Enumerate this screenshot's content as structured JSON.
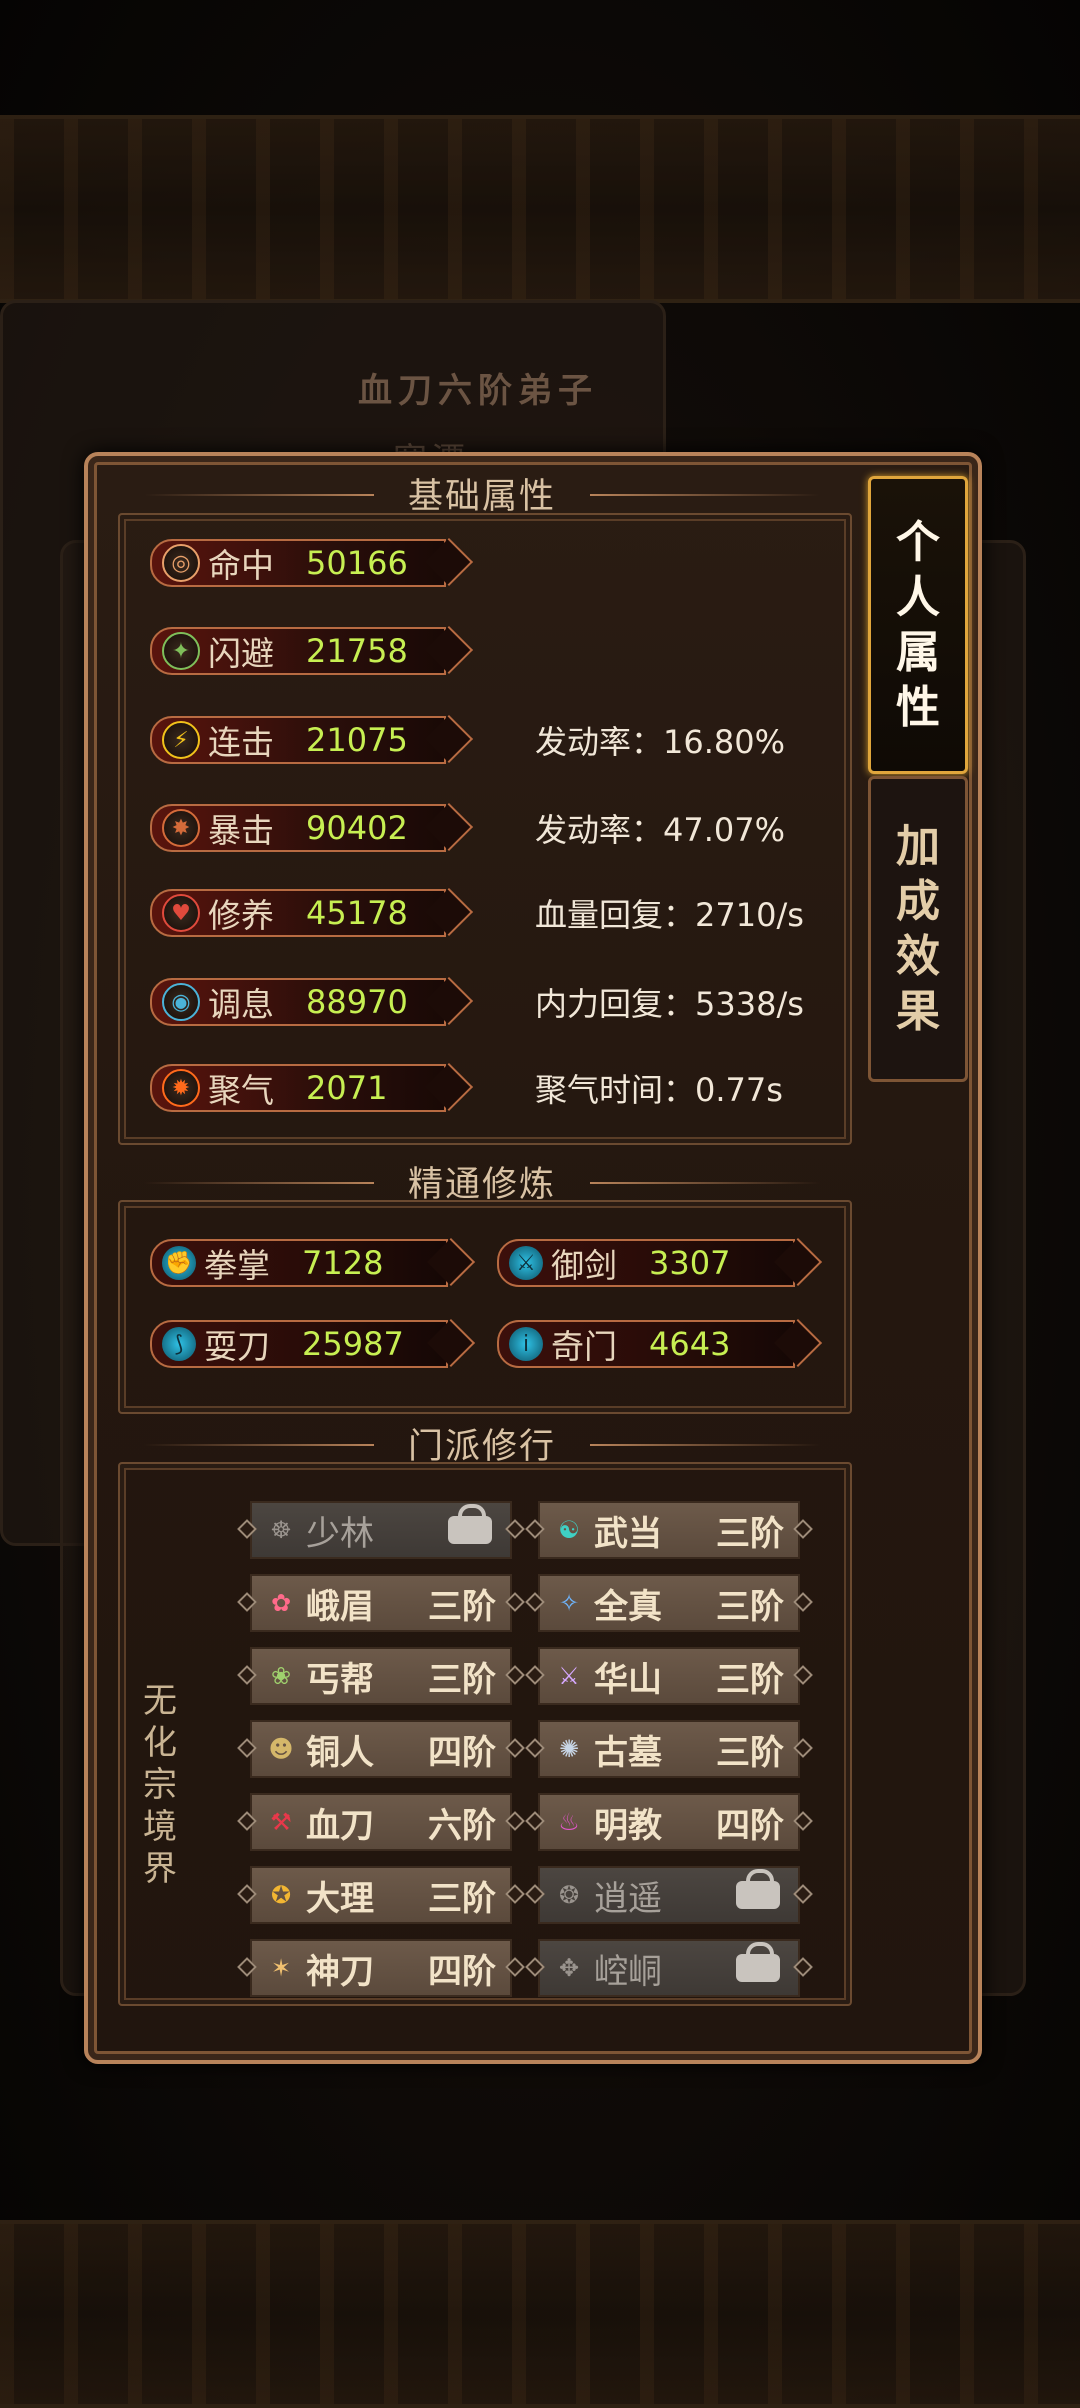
{
  "background": {
    "title_text": "血刀六阶弟子",
    "sub_text": "寒潭"
  },
  "sections": {
    "basic": "基础属性",
    "mastery": "精通修炼",
    "sect": "门派修行"
  },
  "basic_stats": [
    {
      "name": "命中",
      "value": "50166",
      "extra": "",
      "icon": "target-icon",
      "color": "#e8a06a"
    },
    {
      "name": "闪避",
      "value": "21758",
      "extra": "",
      "icon": "dodge-icon",
      "color": "#7fbf5a"
    },
    {
      "name": "连击",
      "value": "21075",
      "extra": "发动率：16.80%",
      "icon": "lightning-icon",
      "color": "#f1c21b"
    },
    {
      "name": "暴击",
      "value": "90402",
      "extra": "发动率：47.07%",
      "icon": "crit-icon",
      "color": "#d46b3a"
    },
    {
      "name": "修养",
      "value": "45178",
      "extra": "血量回复：2710/s",
      "icon": "heart-icon",
      "color": "#e04a3c"
    },
    {
      "name": "调息",
      "value": "88970",
      "extra": "内力回复：5338/s",
      "icon": "breath-icon",
      "color": "#4bb3d8"
    },
    {
      "name": "聚气",
      "value": "2071",
      "extra": "聚气时间：0.77s",
      "icon": "flame-icon",
      "color": "#ff6a1c"
    }
  ],
  "mastery_stats": [
    {
      "name": "拳掌",
      "value": "7128",
      "icon": "fist-icon"
    },
    {
      "name": "御剑",
      "value": "3307",
      "icon": "sword-icon"
    },
    {
      "name": "耍刀",
      "value": "25987",
      "icon": "blade-icon"
    },
    {
      "name": "奇门",
      "value": "4643",
      "icon": "odd-weapon-icon"
    }
  ],
  "realm": "无化宗境界",
  "sects": [
    {
      "name": "少林",
      "level": "",
      "locked": true,
      "icon": "shaolin-icon"
    },
    {
      "name": "武当",
      "level": "三阶",
      "locked": false,
      "icon": "wudang-icon"
    },
    {
      "name": "峨眉",
      "level": "三阶",
      "locked": false,
      "icon": "emei-icon"
    },
    {
      "name": "全真",
      "level": "三阶",
      "locked": false,
      "icon": "quanzhen-icon"
    },
    {
      "name": "丐帮",
      "level": "三阶",
      "locked": false,
      "icon": "gaibang-icon"
    },
    {
      "name": "华山",
      "level": "三阶",
      "locked": false,
      "icon": "huashan-icon"
    },
    {
      "name": "铜人",
      "level": "四阶",
      "locked": false,
      "icon": "tongren-icon"
    },
    {
      "name": "古墓",
      "level": "三阶",
      "locked": false,
      "icon": "gumu-icon"
    },
    {
      "name": "血刀",
      "level": "六阶",
      "locked": false,
      "icon": "xuedao-icon"
    },
    {
      "name": "明教",
      "level": "四阶",
      "locked": false,
      "icon": "mingjiao-icon"
    },
    {
      "name": "大理",
      "level": "三阶",
      "locked": false,
      "icon": "dali-icon"
    },
    {
      "name": "逍遥",
      "level": "",
      "locked": true,
      "icon": "xiaoyao-icon"
    },
    {
      "name": "神刀",
      "level": "四阶",
      "locked": false,
      "icon": "shendao-icon"
    },
    {
      "name": "崆峒",
      "level": "",
      "locked": true,
      "icon": "kongtong-icon"
    }
  ],
  "tabs": [
    {
      "label": "个人属性",
      "active": true
    },
    {
      "label": "加成效果",
      "active": false
    }
  ]
}
